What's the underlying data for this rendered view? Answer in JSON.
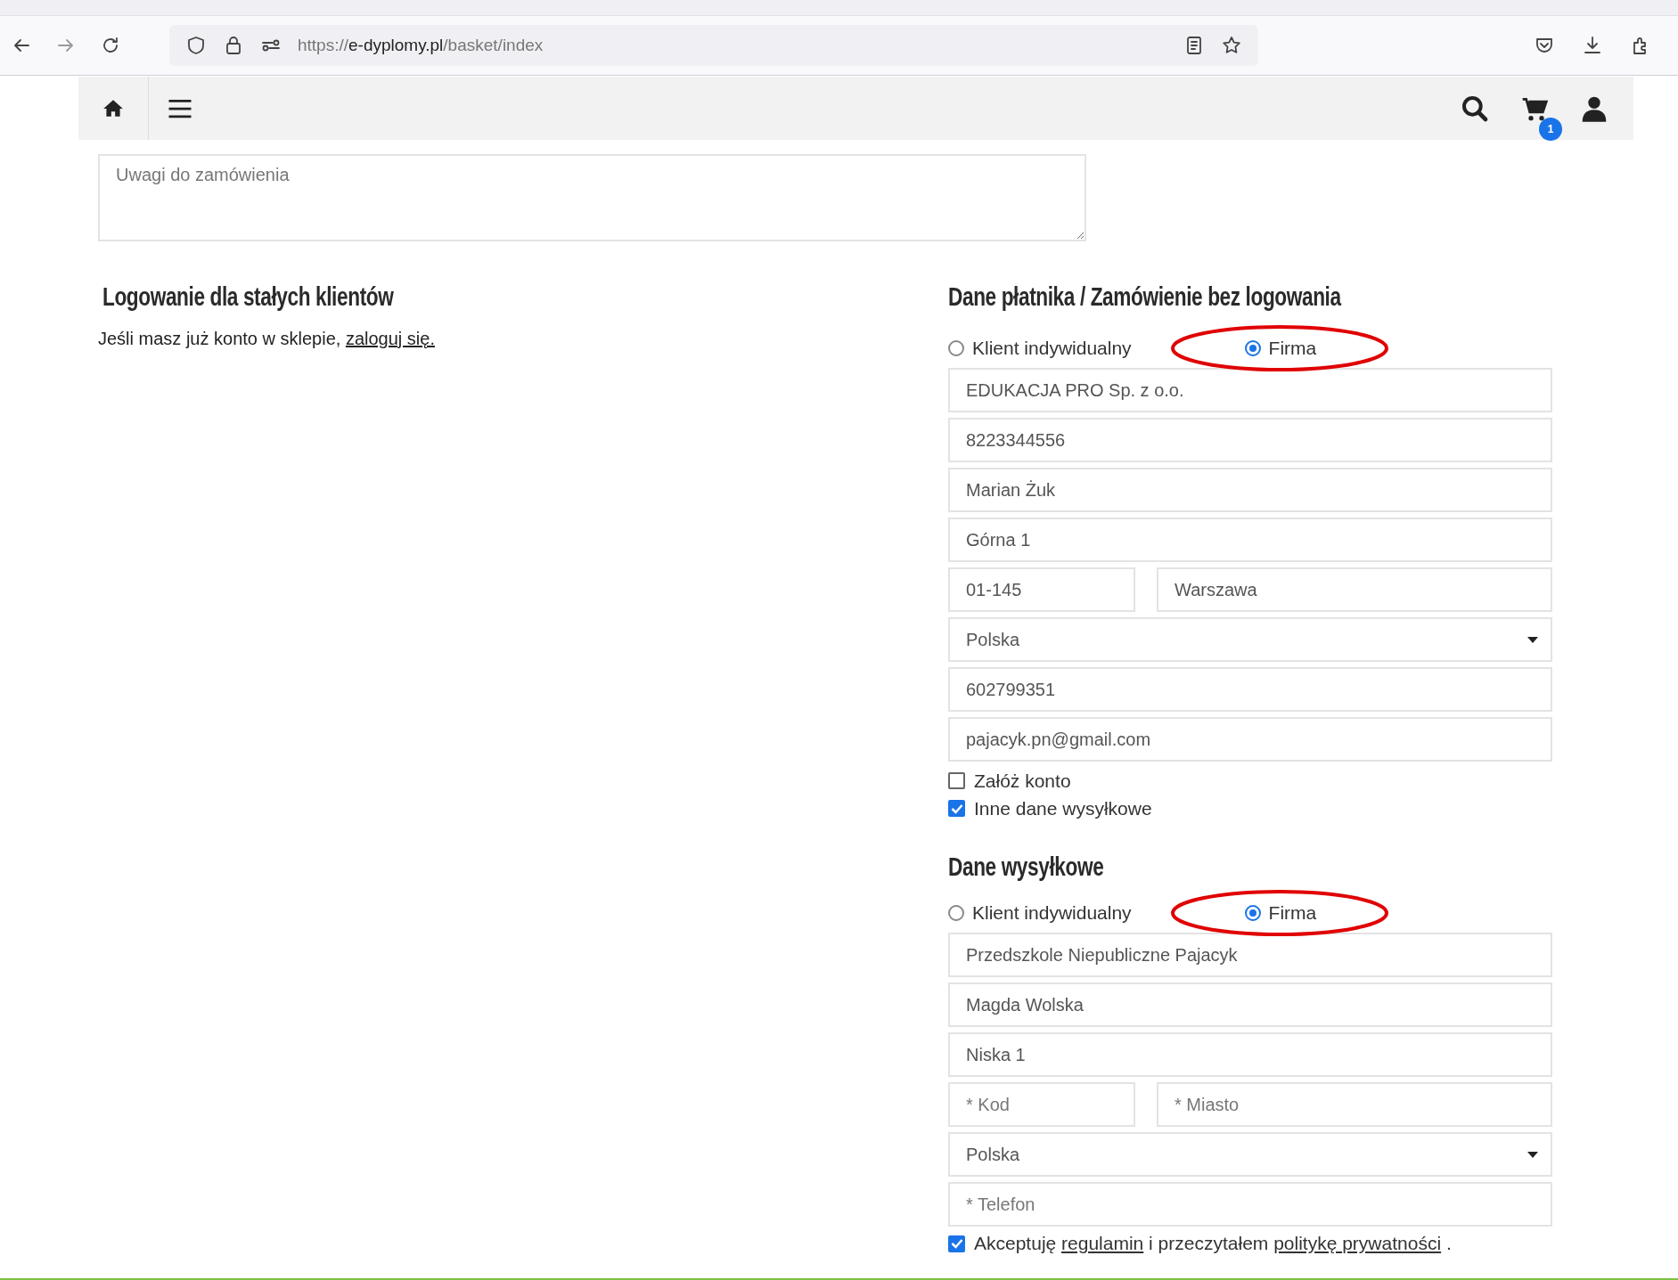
{
  "browser": {
    "url_scheme": "https://",
    "url_host": "e-dyplomy.pl",
    "url_path": "/basket/index"
  },
  "header": {
    "cart_count": "1"
  },
  "notes": {
    "placeholder": "Uwagi do zamówienia"
  },
  "login": {
    "title": "Logowanie dla stałych klientów",
    "text": "Jeśli masz już konto w sklepie, ",
    "link": "zaloguj się."
  },
  "payer": {
    "title": "Dane płatnika / Zamówienie bez logowania",
    "customer_types": [
      {
        "label": "Klient indywidualny",
        "selected": false,
        "circled": false
      },
      {
        "label": "Firma",
        "selected": true,
        "circled": true
      }
    ],
    "fields": [
      {
        "kind": "text",
        "value": "EDUKACJA PRO Sp. z o.o."
      },
      {
        "kind": "text",
        "value": "8223344556"
      },
      {
        "kind": "text",
        "value": "Marian Żuk"
      },
      {
        "kind": "text",
        "value": "Górna 1"
      },
      {
        "kind": "pair",
        "items": [
          {
            "value": "01-145"
          },
          {
            "value": "Warszawa"
          }
        ]
      },
      {
        "kind": "select",
        "value": "Polska"
      },
      {
        "kind": "text",
        "value": "602799351"
      },
      {
        "kind": "text",
        "value": "pajacyk.pn@gmail.com"
      }
    ],
    "options": [
      {
        "label": "Załóż konto",
        "checked": false
      },
      {
        "label": "Inne dane wysyłkowe",
        "checked": true
      }
    ]
  },
  "shipping": {
    "title": "Dane wysyłkowe",
    "customer_types": [
      {
        "label": "Klient indywidualny",
        "selected": false,
        "circled": false
      },
      {
        "label": "Firma",
        "selected": true,
        "circled": true
      }
    ],
    "fields": [
      {
        "kind": "text",
        "value": "Przedszkole Niepubliczne Pajacyk"
      },
      {
        "kind": "text",
        "value": "Magda Wolska"
      },
      {
        "kind": "text",
        "value": "Niska 1"
      },
      {
        "kind": "pair",
        "items": [
          {
            "placeholder": "* Kod"
          },
          {
            "placeholder": "* Miasto"
          }
        ]
      },
      {
        "kind": "select",
        "value": "Polska"
      },
      {
        "kind": "text",
        "placeholder": "* Telefon"
      }
    ]
  },
  "consent": {
    "checked": true,
    "parts": [
      {
        "kind": "text",
        "text": "Akceptuję "
      },
      {
        "kind": "link",
        "text": "regulamin"
      },
      {
        "kind": "text",
        "text": " i przeczytałem "
      },
      {
        "kind": "link",
        "text": "politykę prywatności"
      },
      {
        "kind": "text",
        "text": " ."
      }
    ]
  }
}
